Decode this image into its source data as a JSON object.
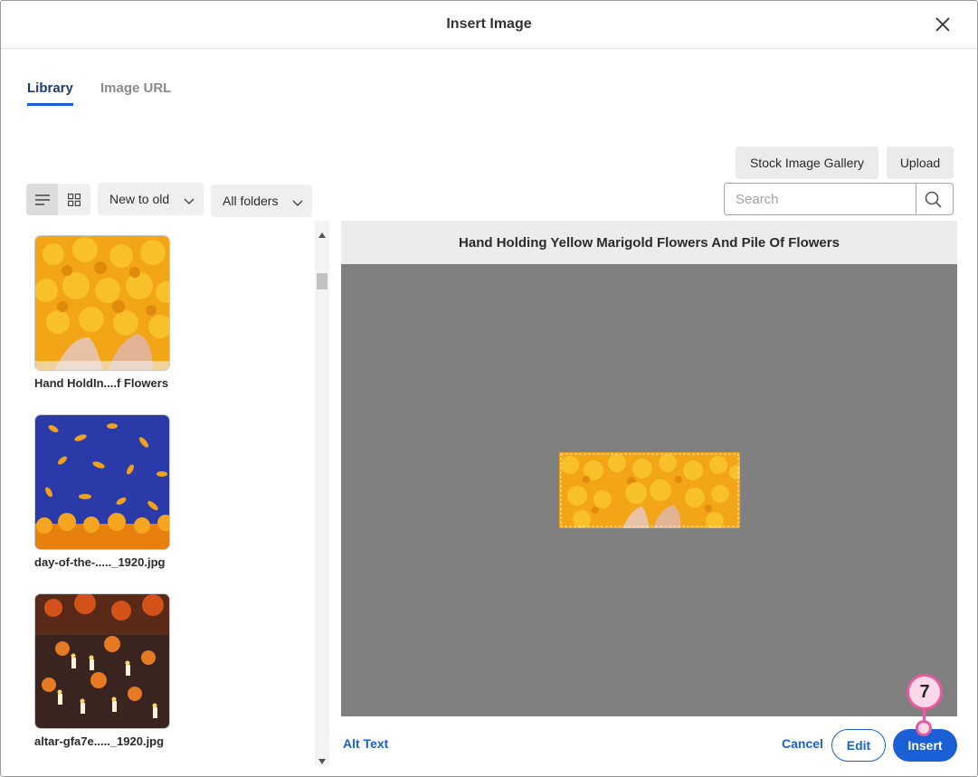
{
  "dialog": {
    "title": "Insert Image",
    "close_icon": "close-icon"
  },
  "tabs": [
    {
      "label": "Library",
      "active": true
    },
    {
      "label": "Image URL",
      "active": false
    }
  ],
  "toolbar": {
    "stock_gallery_label": "Stock Image Gallery",
    "upload_label": "Upload",
    "view_list_icon": "list-view-icon",
    "view_grid_icon": "grid-view-icon",
    "sort_value": "New to old",
    "folder_value": "All folders",
    "search_placeholder": "Search",
    "search_icon": "search-icon"
  },
  "library": {
    "items": [
      {
        "label": "Hand HoldIn....f Flowers"
      },
      {
        "label": "day-of-the-....._1920.jpg"
      },
      {
        "label": "altar-gfa7e....._1920.jpg"
      }
    ]
  },
  "preview": {
    "title": "Hand Holding Yellow Marigold Flowers And Pile Of Flowers"
  },
  "footer": {
    "alt_text_label": "Alt Text",
    "cancel_label": "Cancel",
    "edit_label": "Edit",
    "insert_label": "Insert"
  },
  "annotation": {
    "step_number": "7",
    "color": "#e75a9d"
  },
  "colors": {
    "accent": "#1a5fd6",
    "preview_bg": "#808080"
  }
}
